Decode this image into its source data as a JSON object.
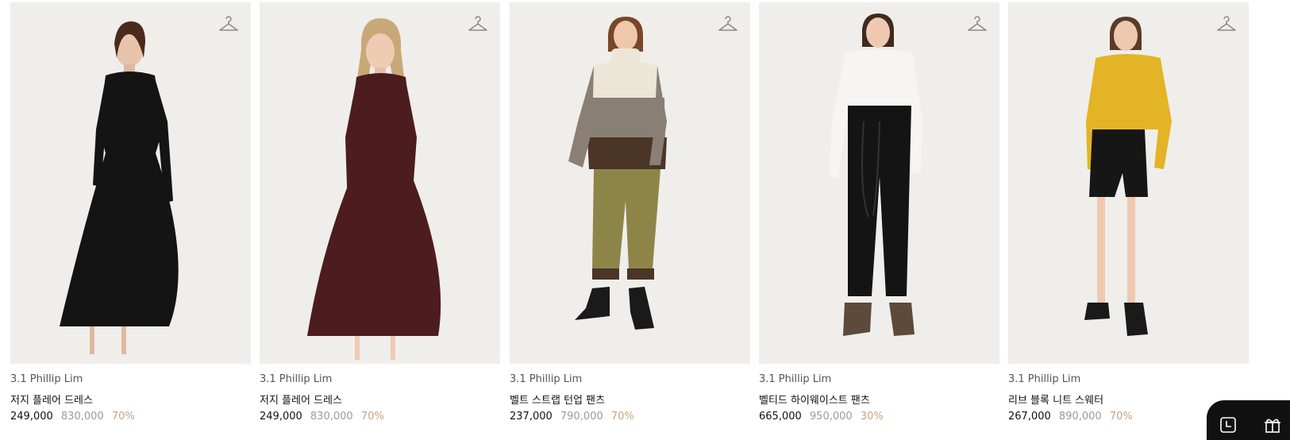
{
  "products": [
    {
      "brand": "3.1 Phillip Lim",
      "name": "저지 플레어 드레스",
      "price": "249,000",
      "original_price": "830,000",
      "discount": "70%",
      "icon": "hanger-icon"
    },
    {
      "brand": "3.1 Phillip Lim",
      "name": "저지 플레어 드레스",
      "price": "249,000",
      "original_price": "830,000",
      "discount": "70%",
      "icon": "hanger-icon"
    },
    {
      "brand": "3.1 Phillip Lim",
      "name": "벨트 스트랩 턴업 팬츠",
      "price": "237,000",
      "original_price": "790,000",
      "discount": "70%",
      "icon": "hanger-icon"
    },
    {
      "brand": "3.1 Phillip Lim",
      "name": "벨티드 하이웨이스트 팬츠",
      "price": "665,000",
      "original_price": "950,000",
      "discount": "30%",
      "icon": "hanger-icon"
    },
    {
      "brand": "3.1 Phillip Lim",
      "name": "리브 블록 니트 스웨터",
      "price": "267,000",
      "original_price": "890,000",
      "discount": "70%",
      "icon": "hanger-icon"
    }
  ],
  "floating_actions": {
    "icons": [
      "clock-icon",
      "gift-icon"
    ]
  },
  "colors": {
    "photo_background": "#efeeea",
    "discount": "#c9a27e",
    "original_price": "#9a9a9a",
    "floating_button": "#111111"
  }
}
